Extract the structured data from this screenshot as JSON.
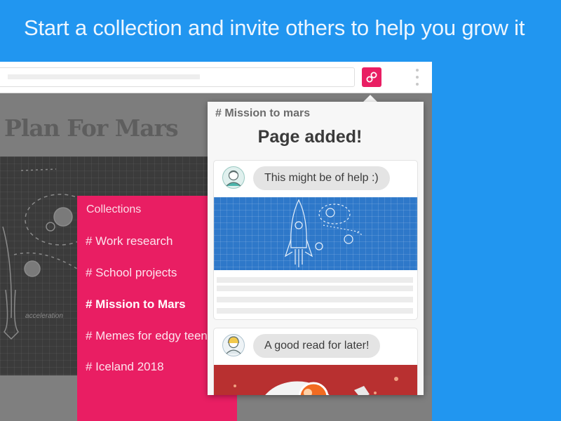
{
  "headline": "Start a collection and invite others to help you grow it",
  "browser": {
    "extension_icon": "link-icon",
    "menu_icon": "more-vert-icon",
    "page_title": "Plan For Mars",
    "blueprint_annotation": "acceleration"
  },
  "collections": {
    "header": "Collections",
    "items": [
      {
        "label": "# Work research",
        "active": false
      },
      {
        "label": "# School projects",
        "active": false
      },
      {
        "label": "# Mission to Mars",
        "active": true
      },
      {
        "label": "# Memes for edgy teens",
        "active": false
      },
      {
        "label": "# Iceland 2018",
        "active": false
      }
    ]
  },
  "popup": {
    "collection_tag": "# Mission to mars",
    "title": "Page added!",
    "cards": [
      {
        "comment": "This might be of help :)",
        "image": "rocket-blueprint-image",
        "avatar": "user-avatar-icon"
      },
      {
        "comment": "A good read for later!",
        "image": "astronaut-illustration-image",
        "avatar": "user-avatar-icon"
      }
    ]
  },
  "colors": {
    "background": "#2196f0",
    "accent": "#e91e63",
    "blueprint": "#2e78c9"
  }
}
